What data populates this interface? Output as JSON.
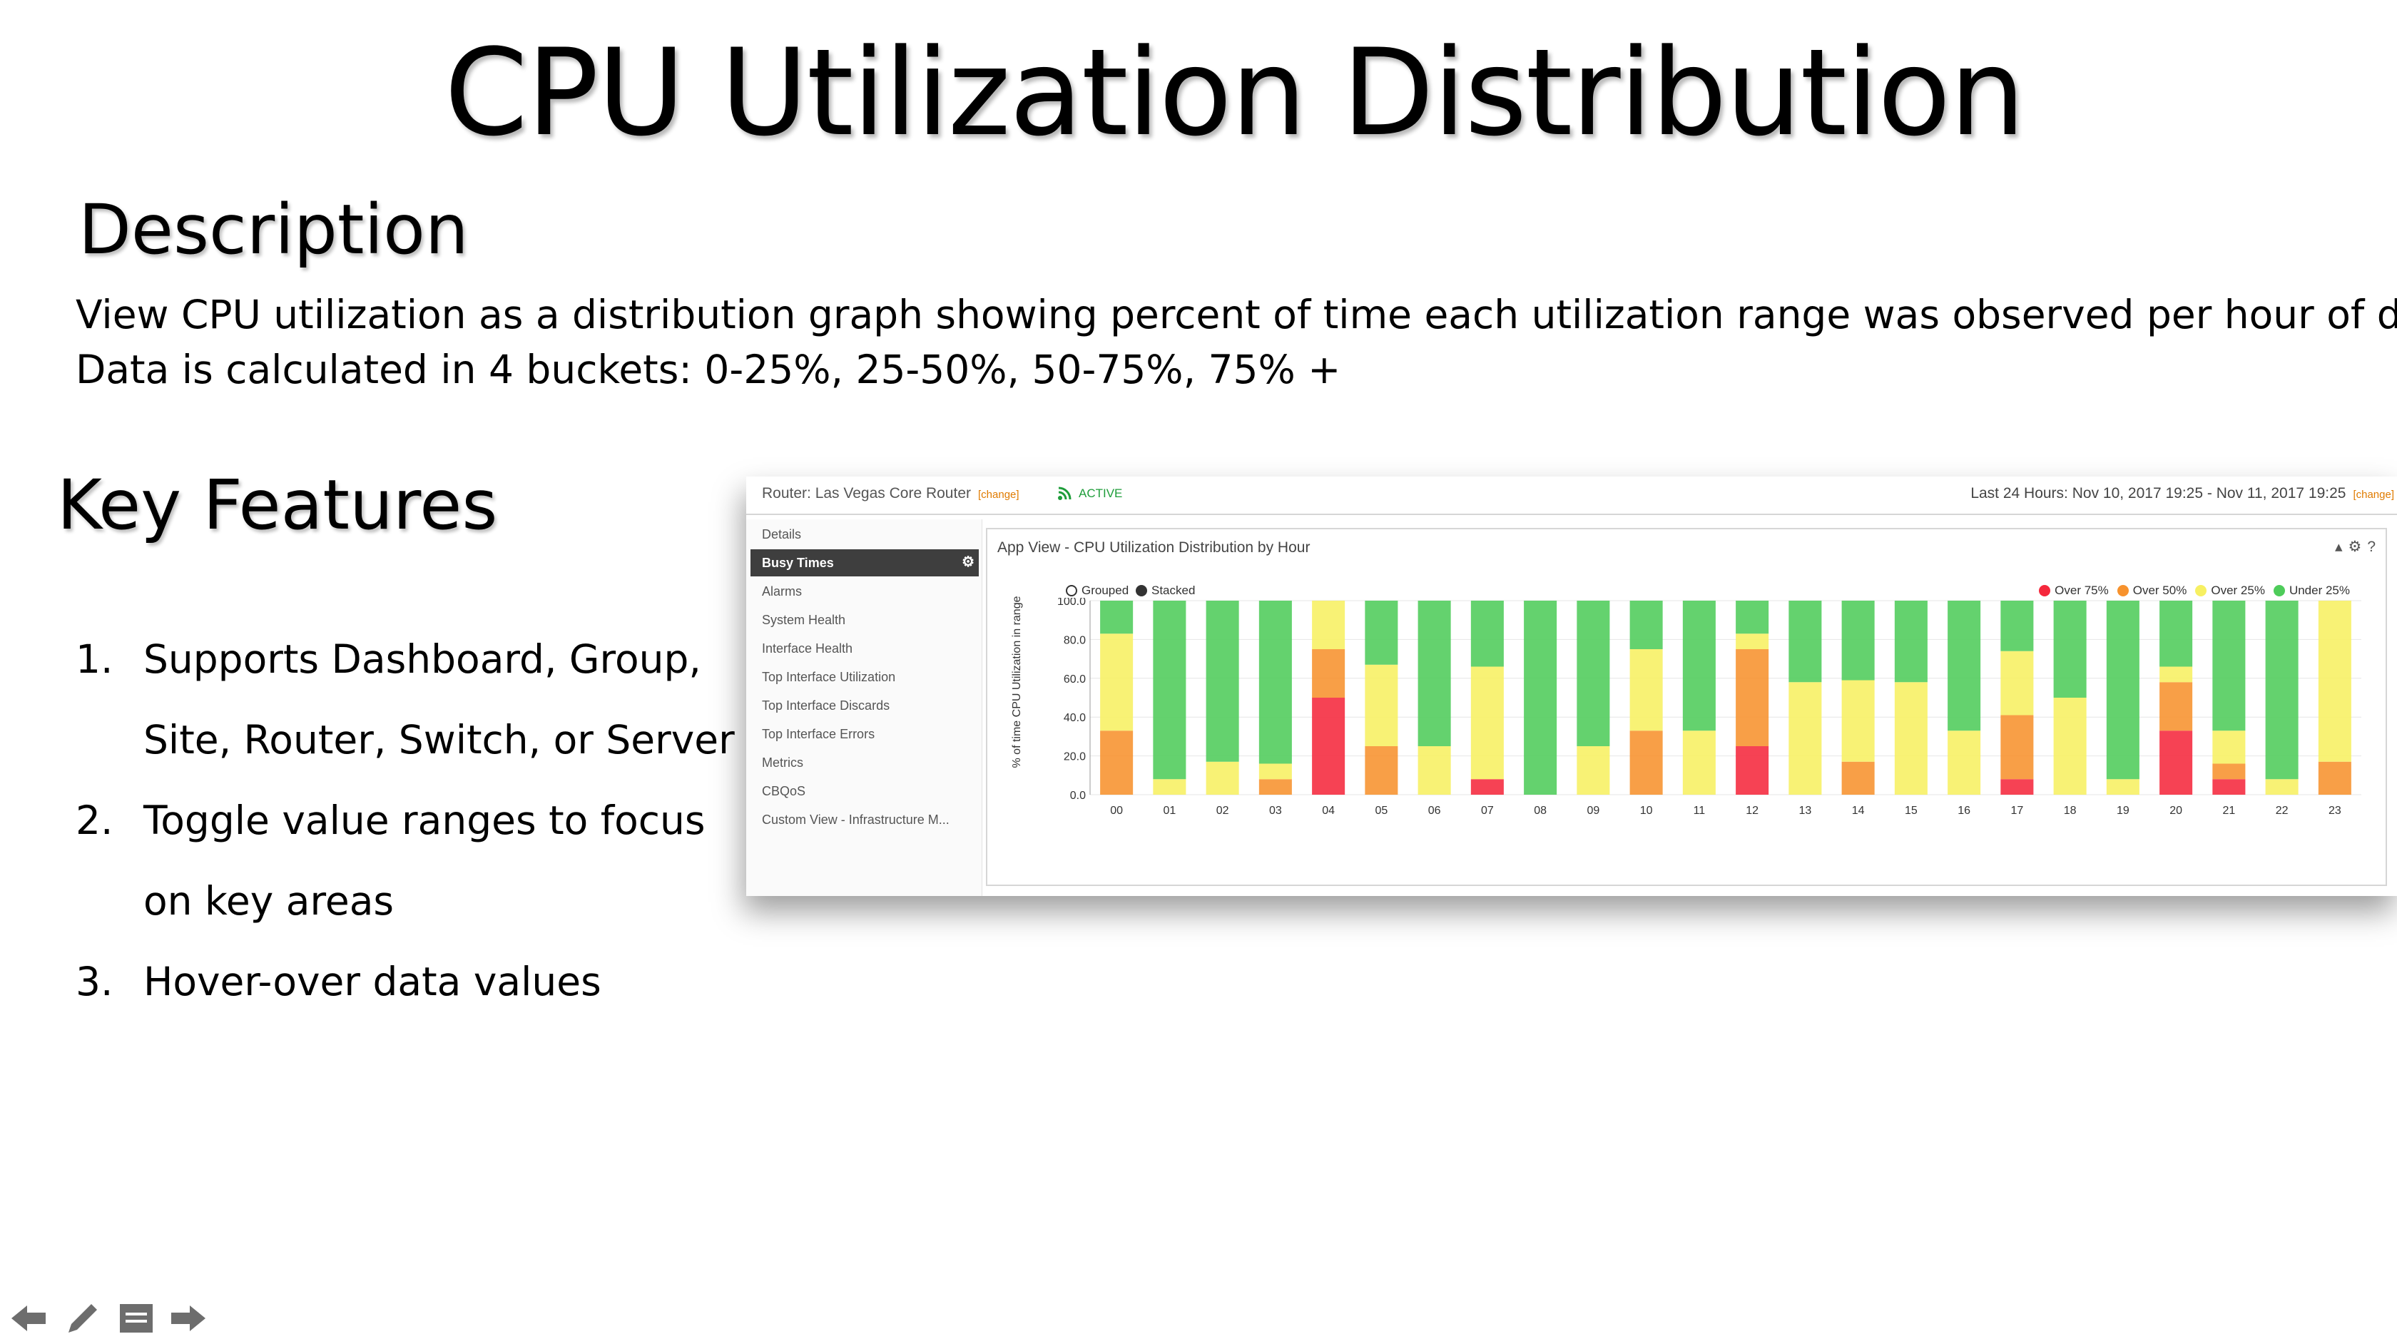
{
  "slide": {
    "title": "CPU Utilization Distribution",
    "description_heading": "Description",
    "description_lines": [
      "View CPU utilization as a distribution graph showing percent of time each utilization range was observed per hour of day.",
      "Data is calculated in 4 buckets: 0-25%, 25-50%, 50-75%, 75% +"
    ],
    "features_heading": "Key Features",
    "features": [
      {
        "num": "1.",
        "text": "Supports Dashboard, Group, Site, Router, Switch, or Server"
      },
      {
        "num": "2.",
        "text": "Toggle value ranges to focus on key areas"
      },
      {
        "num": "3.",
        "text": "Hover-over data values"
      }
    ]
  },
  "app": {
    "router_label": "Router: Las Vegas Core Router",
    "change_label": "[change]",
    "status": "ACTIVE",
    "time_range": "Last 24 Hours: Nov 10, 2017 19:25 - Nov 11, 2017 19:25",
    "sidebar": [
      {
        "label": "Details",
        "selected": false
      },
      {
        "label": "Busy Times",
        "selected": true
      },
      {
        "label": "Alarms",
        "selected": false
      },
      {
        "label": "System Health",
        "selected": false
      },
      {
        "label": "Interface Health",
        "selected": false
      },
      {
        "label": "Top Interface Utilization",
        "selected": false
      },
      {
        "label": "Top Interface Discards",
        "selected": false
      },
      {
        "label": "Top Interface Errors",
        "selected": false
      },
      {
        "label": "Metrics",
        "selected": false
      },
      {
        "label": "CBQoS",
        "selected": false
      },
      {
        "label": "Custom View - Infrastructure M...",
        "selected": false
      }
    ],
    "panel_title": "App View - CPU Utilization Distribution by Hour",
    "panel_tools": [
      "▴",
      "⚙",
      "?"
    ],
    "toggles": {
      "grouped": "Grouped",
      "stacked": "Stacked",
      "selected": "stacked"
    },
    "colors": {
      "over75": "#f5283c",
      "over50": "#f7922d",
      "over25": "#f7f062",
      "under25": "#4ecc5a"
    }
  },
  "chart_data": {
    "type": "bar",
    "stacked": true,
    "title": "",
    "xlabel": "",
    "ylabel": "% of time CPU Utilization in range",
    "ylim": [
      0,
      100
    ],
    "yticks": [
      "100.0",
      "80.0",
      "60.0",
      "40.0",
      "20.0",
      "0.0"
    ],
    "legend_position": "top-right",
    "categories": [
      "00",
      "01",
      "02",
      "03",
      "04",
      "05",
      "06",
      "07",
      "08",
      "09",
      "10",
      "11",
      "12",
      "13",
      "14",
      "15",
      "16",
      "17",
      "18",
      "19",
      "20",
      "21",
      "22",
      "23"
    ],
    "series": [
      {
        "name": "Over 75%",
        "color": "#f5283c",
        "values": [
          0,
          0,
          0,
          0,
          50,
          0,
          0,
          8,
          0,
          0,
          0,
          0,
          25,
          0,
          0,
          0,
          0,
          8,
          0,
          0,
          33,
          8,
          0,
          0
        ]
      },
      {
        "name": "Over 50%",
        "color": "#f7922d",
        "values": [
          33,
          0,
          0,
          8,
          25,
          25,
          0,
          0,
          0,
          0,
          33,
          0,
          50,
          0,
          17,
          0,
          0,
          33,
          0,
          0,
          25,
          8,
          0,
          17
        ]
      },
      {
        "name": "Over 25%",
        "color": "#f7f062",
        "values": [
          50,
          8,
          17,
          8,
          25,
          42,
          25,
          58,
          0,
          25,
          42,
          33,
          8,
          58,
          42,
          58,
          33,
          33,
          50,
          8,
          8,
          17,
          8,
          83
        ]
      },
      {
        "name": "Under 25%",
        "color": "#4ecc5a",
        "values": [
          17,
          92,
          83,
          84,
          0,
          33,
          75,
          34,
          100,
          75,
          25,
          67,
          17,
          42,
          41,
          42,
          67,
          26,
          50,
          92,
          34,
          67,
          92,
          0
        ]
      }
    ]
  }
}
